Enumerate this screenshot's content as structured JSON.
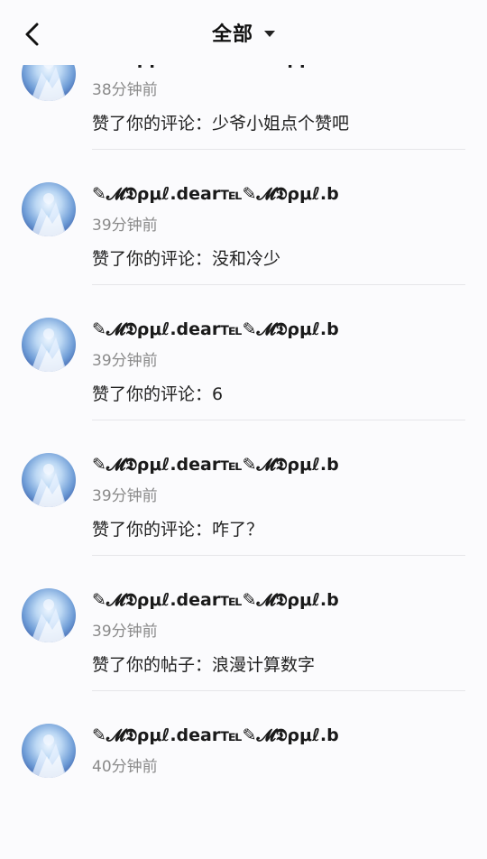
{
  "header": {
    "title": "全部",
    "back_icon": "chevron-left-icon",
    "dropdown_icon": "caret-down-icon"
  },
  "notifications": [
    {
      "name": "✎𝓜𝕯ρμℓ.dear℡✎𝓜𝕯ρμℓ.b",
      "time": "38分钟前",
      "action": "赞了你的评论：少爷小姐点个赞吧"
    },
    {
      "name": "✎𝓜𝕯ρμℓ.dear℡✎𝓜𝕯ρμℓ.b",
      "time": "39分钟前",
      "action": "赞了你的评论：没和冷少"
    },
    {
      "name": "✎𝓜𝕯ρμℓ.dear℡✎𝓜𝕯ρμℓ.b",
      "time": "39分钟前",
      "action": "赞了你的评论：6"
    },
    {
      "name": "✎𝓜𝕯ρμℓ.dear℡✎𝓜𝕯ρμℓ.b",
      "time": "39分钟前",
      "action": "赞了你的评论：咋了？"
    },
    {
      "name": "✎𝓜𝕯ρμℓ.dear℡✎𝓜𝕯ρμℓ.b",
      "time": "39分钟前",
      "action": "赞了你的帖子：浪漫计算数字"
    },
    {
      "name": "✎𝓜𝕯ρμℓ.dear℡✎𝓜𝕯ρμℓ.b",
      "time": "40分钟前",
      "action": ""
    }
  ]
}
